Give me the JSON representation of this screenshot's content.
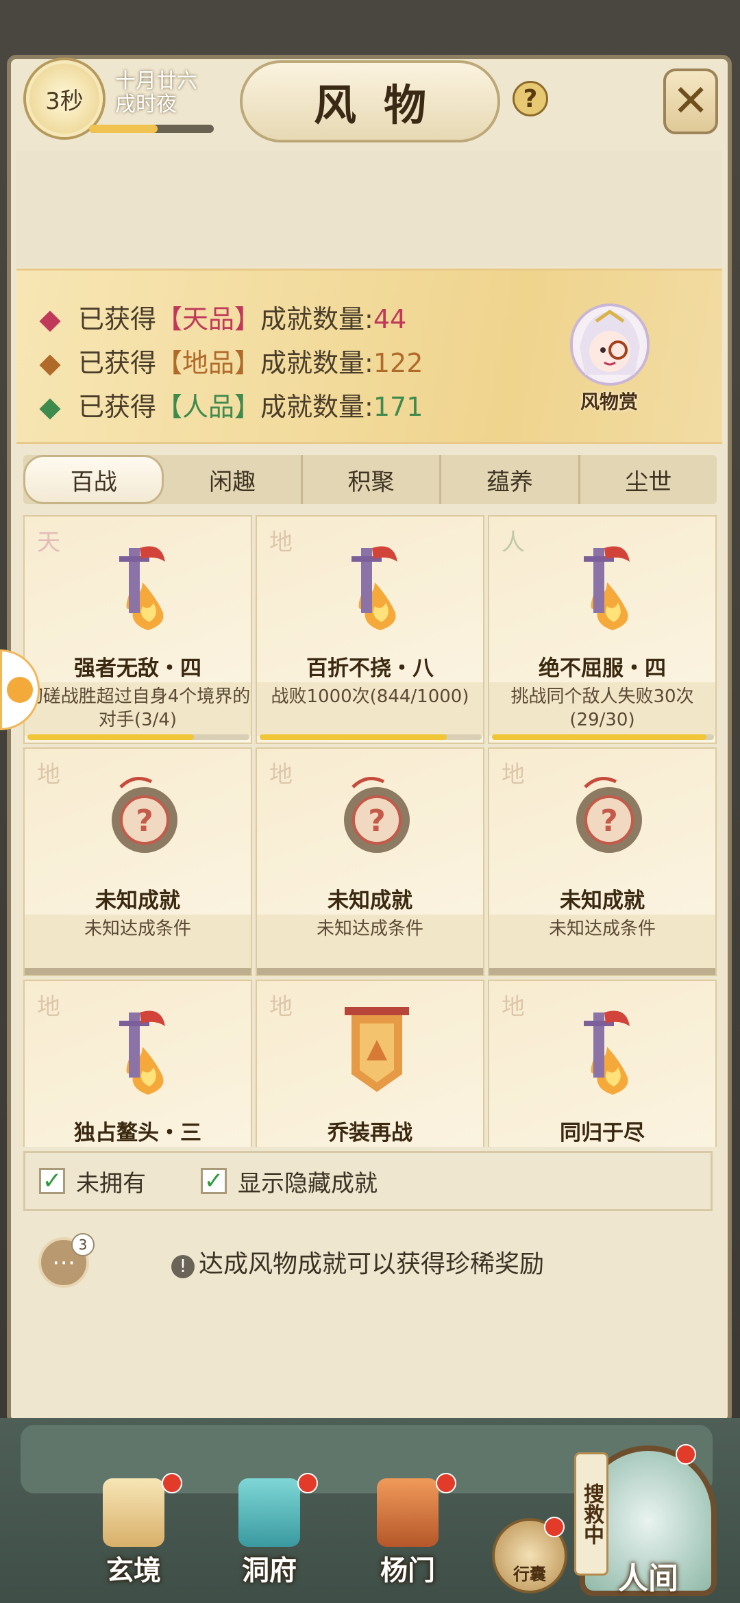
{
  "header": {
    "timer": "3秒",
    "date_line1": "十月廿六",
    "date_line2": "戌时夜",
    "progress": 0.55,
    "title": "风物",
    "help_label": "?",
    "close_label": "✕"
  },
  "banner": {
    "stats": [
      {
        "prefix": "已获得",
        "grade": "【天品】",
        "suffix": "成就数量:",
        "count": "44",
        "color": "#c0395a"
      },
      {
        "prefix": "已获得",
        "grade": "【地品】",
        "suffix": "成就数量:",
        "count": "122",
        "color": "#b06a2a"
      },
      {
        "prefix": "已获得",
        "grade": "【人品】",
        "suffix": "成就数量:",
        "count": "171",
        "color": "#3f8a4d"
      }
    ],
    "mascot_label": "风物赏"
  },
  "tabs": [
    "百战",
    "闲趣",
    "积聚",
    "蕴养",
    "尘世"
  ],
  "cards": [
    {
      "grade": "天",
      "name": "强者无敌・四",
      "desc": "切磋战胜超过自身4个境界的对手(3/4)",
      "icon": "sword-flame-icon",
      "progress": 0.75
    },
    {
      "grade": "地",
      "name": "百折不挠・八",
      "desc": "战败1000次(844/1000)",
      "icon": "sword-flame-icon",
      "progress": 0.844
    },
    {
      "grade": "人",
      "name": "绝不屈服・四",
      "desc": "挑战同个敌人失败30次(29/30)",
      "icon": "sword-flame-icon",
      "progress": 0.967
    },
    {
      "grade": "地",
      "name": "未知成就",
      "desc": "未知达成条件",
      "icon": "question-seal-icon"
    },
    {
      "grade": "地",
      "name": "未知成就",
      "desc": "未知达成条件",
      "icon": "question-seal-icon"
    },
    {
      "grade": "地",
      "name": "未知成就",
      "desc": "未知达成条件",
      "icon": "question-seal-icon"
    },
    {
      "grade": "地",
      "name": "独占鳌头・三",
      "desc": "",
      "icon": "sword-flame-icon"
    },
    {
      "grade": "地",
      "name": "乔装再战",
      "desc": "",
      "icon": "banner-shield-icon"
    },
    {
      "grade": "地",
      "name": "同归于尽",
      "desc": "",
      "icon": "sword-flame-icon"
    }
  ],
  "filters": {
    "not_owned": "未拥有",
    "show_hidden": "显示隐藏成就"
  },
  "chat_badge": "3",
  "tip": "达成风物成就可以获得珍稀奖励",
  "nav": {
    "items": [
      {
        "label": "玄境"
      },
      {
        "label": "洞府"
      },
      {
        "label": "杨门"
      }
    ],
    "bag_label": "行囊",
    "search_label": "搜救中",
    "world_label": "人间"
  }
}
